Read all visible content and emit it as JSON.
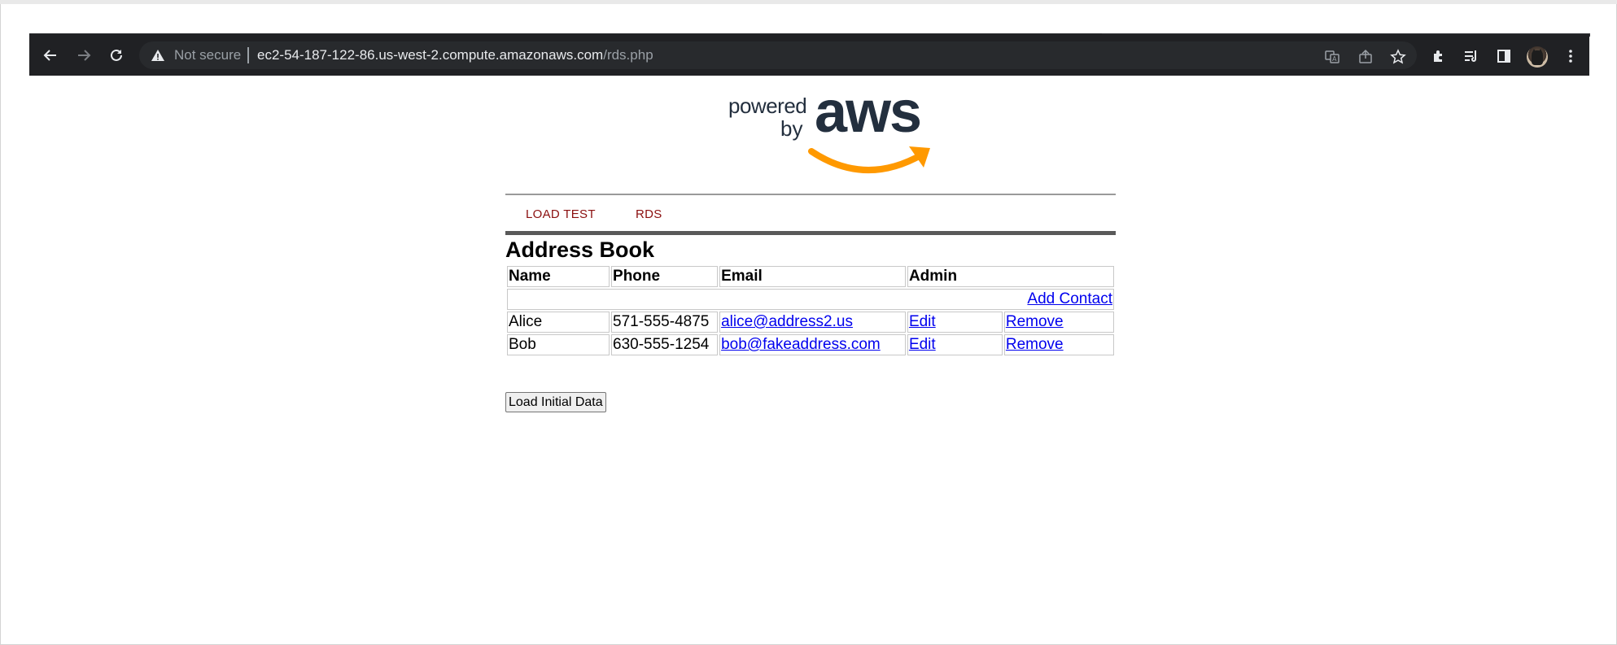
{
  "browser": {
    "security_label": "Not secure",
    "url_host": "ec2-54-187-122-86.us-west-2.compute.amazonaws.com",
    "url_path": "/rds.php"
  },
  "logo": {
    "powered": "powered",
    "by": "by",
    "brand": "aws",
    "brand_color": "#232f3e",
    "smile_color": "#ff9900"
  },
  "nav": {
    "items": [
      {
        "label": "LOAD TEST"
      },
      {
        "label": "RDS"
      }
    ],
    "link_color": "#8b0f0f"
  },
  "page": {
    "title": "Address Book"
  },
  "table": {
    "headers": [
      "Name",
      "Phone",
      "Email",
      "Admin"
    ],
    "add_contact_label": "Add Contact",
    "rows": [
      {
        "name": "Alice",
        "phone": "571-555-4875",
        "email": "alice@address2.us",
        "edit": "Edit",
        "remove": "Remove"
      },
      {
        "name": "Bob",
        "phone": "630-555-1254",
        "email": "bob@fakeaddress.com",
        "edit": "Edit",
        "remove": "Remove"
      }
    ]
  },
  "actions": {
    "load_initial_data": "Load Initial Data"
  }
}
